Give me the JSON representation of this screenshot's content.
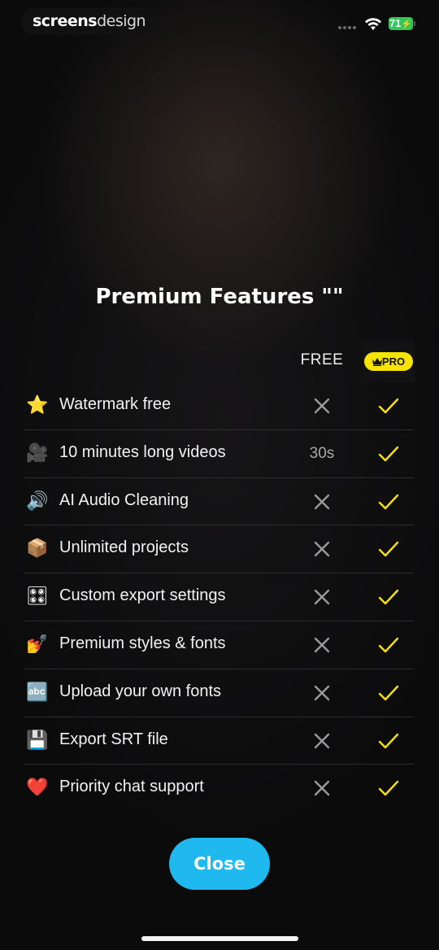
{
  "status_bar": {
    "watermark_bold": "screens",
    "watermark_light": "design",
    "battery": "71",
    "wifi_icon": "wifi-icon",
    "battery_color": "#31c75a"
  },
  "title": "Premium Features \"\"",
  "columns": {
    "free": "FREE",
    "pro": "PRO",
    "pro_badge_color": "#f6e300"
  },
  "features": [
    {
      "emoji": "⭐",
      "label": "Watermark free",
      "free": "x",
      "pro": "check"
    },
    {
      "emoji": "🎥",
      "label": "10 minutes long videos",
      "free": "30s",
      "pro": "check"
    },
    {
      "emoji": "🔊",
      "label": "AI Audio Cleaning",
      "free": "x",
      "pro": "check"
    },
    {
      "emoji": "📦",
      "label": "Unlimited projects",
      "free": "x",
      "pro": "check"
    },
    {
      "emoji": "🎛",
      "label": "Custom export settings",
      "free": "x",
      "pro": "check"
    },
    {
      "emoji": "💅",
      "label": "Premium styles & fonts",
      "free": "x",
      "pro": "check"
    },
    {
      "emoji": "🔤",
      "label": "Upload your own fonts",
      "free": "x",
      "pro": "check"
    },
    {
      "emoji": "💾",
      "label": "Export SRT file",
      "free": "x",
      "pro": "check"
    },
    {
      "emoji": "❤️",
      "label": "Priority chat support",
      "free": "x",
      "pro": "check"
    }
  ],
  "close_button": "Close",
  "colors": {
    "accent": "#1fb8ef",
    "check": "#f6e300",
    "cross": "#9a9a9a"
  }
}
